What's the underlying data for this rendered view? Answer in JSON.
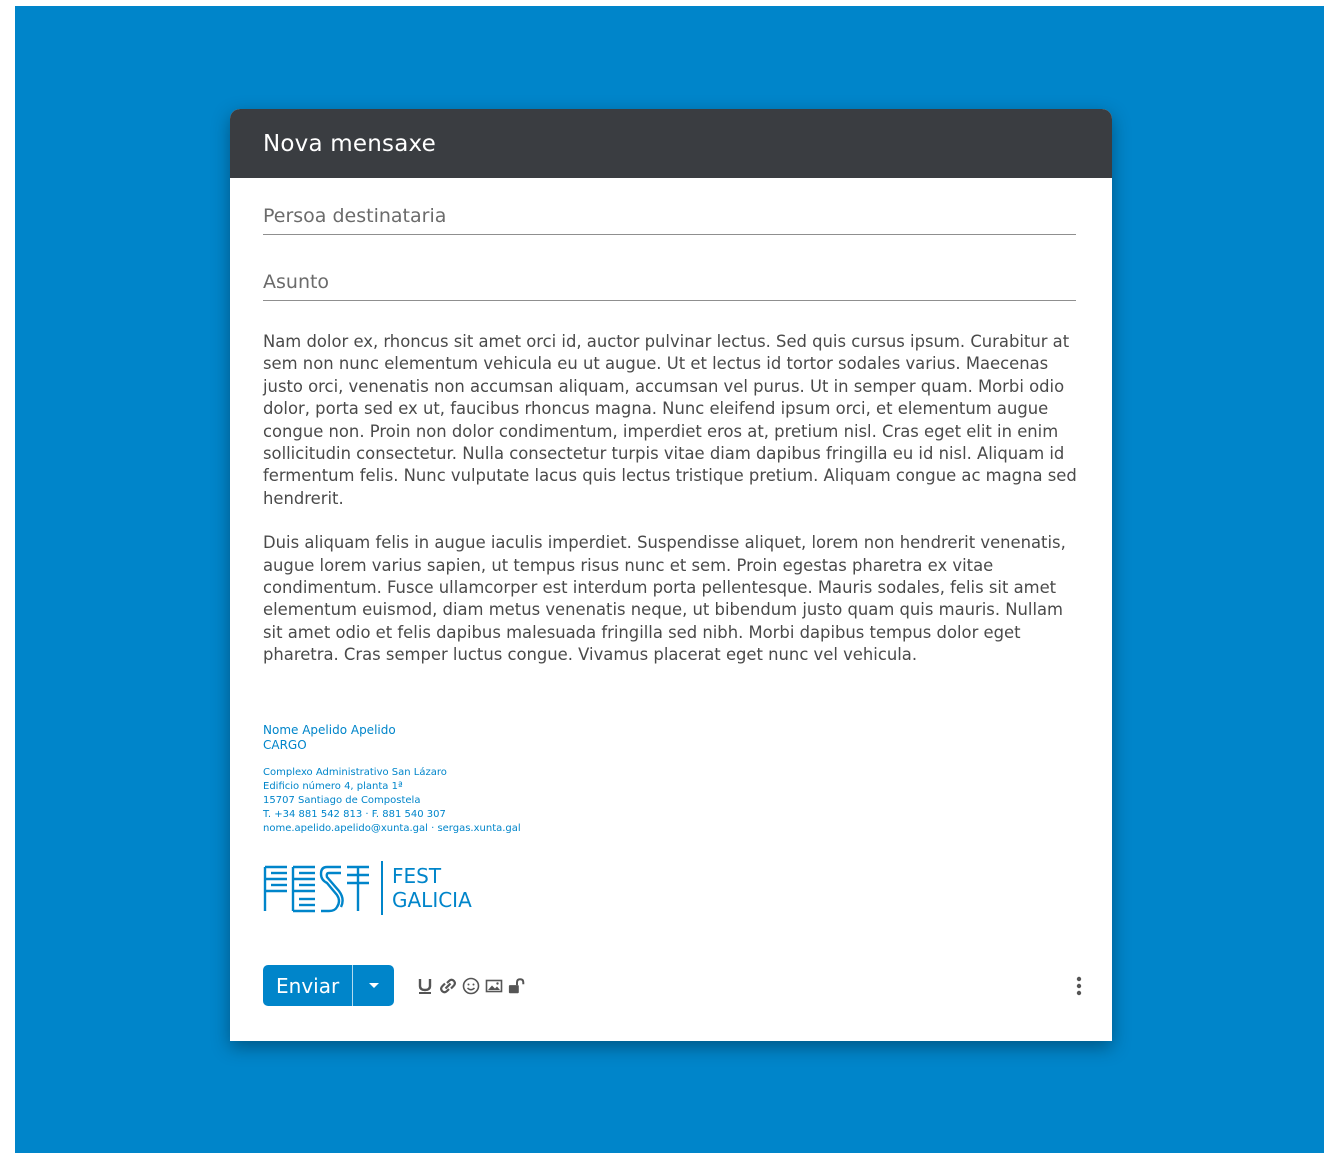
{
  "compose": {
    "title": "Nova mensaxe",
    "to_placeholder": "Persoa destinataria",
    "subject_placeholder": "Asunto",
    "body": [
      "Nam dolor ex, rhoncus sit amet orci id, auctor pulvinar lectus. Sed quis cursus ipsum. Curabitur at sem non nunc elementum vehicula eu ut augue. Ut et lectus id tortor sodales varius. Maecenas justo orci, venenatis non accumsan aliquam, accumsan vel purus. Ut in semper quam. Morbi odio dolor, porta sed ex ut, faucibus rhoncus magna. Nunc eleifend ipsum orci, et elementum augue congue non. Proin non dolor condimentum, imperdiet eros at, pretium nisl. Cras eget elit in enim sollicitudin consectetur. Nulla consectetur turpis vitae diam dapibus fringilla eu id nisl. Aliquam id fermentum felis. Nunc vulputate lacus quis lectus tristique pretium. Aliquam congue ac magna sed hendrerit.",
      "Duis aliquam felis in augue iaculis imperdiet. Suspendisse aliquet, lorem non hendrerit venenatis, augue lorem varius sapien, ut tempus risus nunc et sem. Proin egestas pharetra ex vitae condimentum. Fusce ullamcorper est interdum porta pellentesque. Mauris sodales, felis sit amet elementum euismod, diam metus venenatis neque, ut bibendum justo quam quis mauris. Nullam sit amet odio et felis dapibus malesuada fringilla sed nibh. Morbi dapibus tempus dolor eget pharetra. Cras semper luctus congue. Vivamus placerat eget nunc vel vehicula."
    ]
  },
  "signature": {
    "name": "Nome Apelido Apelido",
    "position": "CARGO",
    "address_lines": [
      "Complexo Administrativo San Lázaro",
      "Edificio número 4, planta 1ª",
      "15707 Santiago de Compostela",
      "T. +34 881 542 813 · F. 881 540 307",
      "nome.apelido.apelido@xunta.gal · sergas.xunta.gal"
    ],
    "logo_text_1": "FEST",
    "logo_text_2": "GALICIA"
  },
  "toolbar": {
    "send_label": "Enviar",
    "icons": [
      "underline-icon",
      "link-icon",
      "emoji-icon",
      "image-icon",
      "unlock-icon",
      "more-vertical-icon"
    ]
  },
  "colors": {
    "background": "#0085CA",
    "header": "#3A3D41",
    "accent": "#0085CA"
  }
}
